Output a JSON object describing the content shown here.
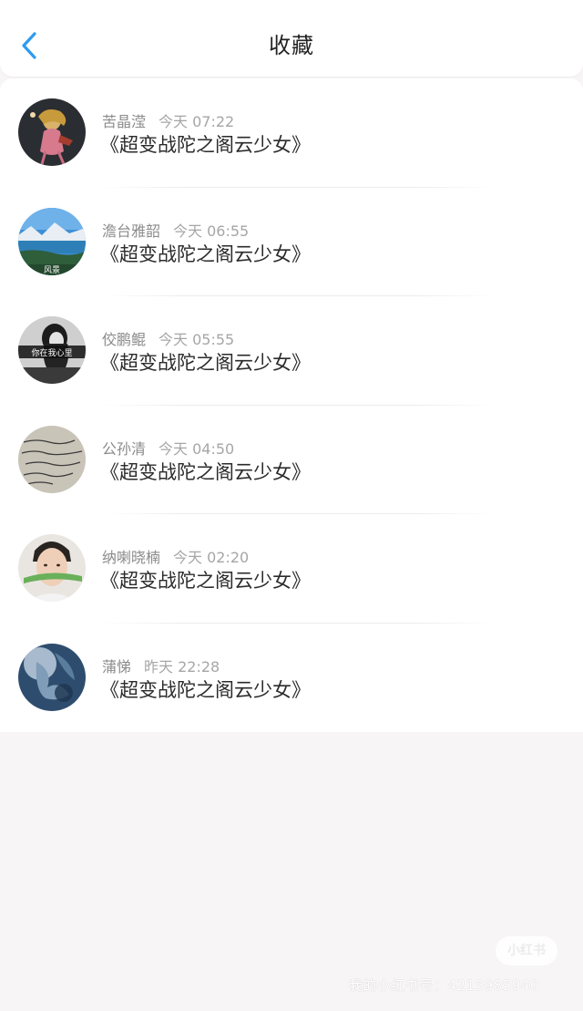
{
  "header": {
    "title": "收藏",
    "back_icon": "chevron-left-icon",
    "accent_color": "#2f9bf0"
  },
  "favorites": [
    {
      "user": "苦晶滢",
      "time": "今天 07:22",
      "book": "《超变战陀之阁云少女》",
      "avatar": "anime-girl-avatar"
    },
    {
      "user": "澹台雅韶",
      "time": "今天 06:55",
      "book": "《超变战陀之阁云少女》",
      "avatar": "landscape-avatar",
      "avatar_caption": "风景"
    },
    {
      "user": "佼鹏鲲",
      "time": "今天 05:55",
      "book": "《超变战陀之阁云少女》",
      "avatar": "bw-girl-avatar",
      "avatar_caption": "你在我心里"
    },
    {
      "user": "公孙清",
      "time": "今天 04:50",
      "book": "《超变战陀之阁云少女》",
      "avatar": "handwriting-avatar"
    },
    {
      "user": "纳喇晓楠",
      "time": "今天 02:20",
      "book": "《超变战陀之阁云少女》",
      "avatar": "man-portrait-avatar"
    },
    {
      "user": "蒲悌",
      "time": "昨天 22:28",
      "book": "《超变战陀之阁云少女》",
      "avatar": "blue-abstract-avatar"
    }
  ],
  "watermark": {
    "logo": "小红书",
    "text": "我的小红书号：4215985940"
  }
}
